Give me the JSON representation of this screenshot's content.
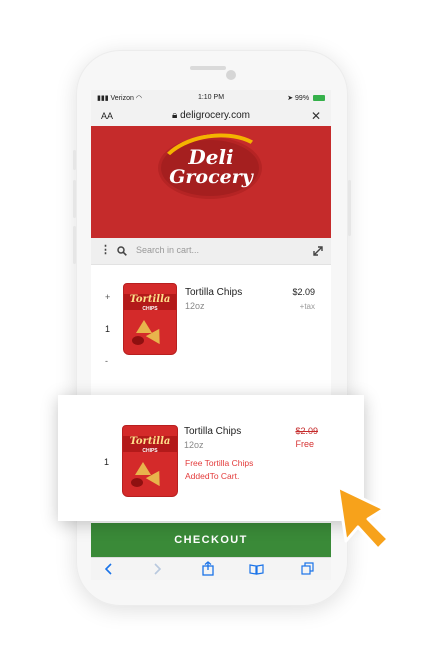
{
  "status_bar": {
    "carrier": "Verizon",
    "time": "1:10 PM",
    "battery": "99%"
  },
  "browser": {
    "text_size": "AA",
    "url": "deligrocery.com",
    "close": "✕"
  },
  "brand": {
    "logo_line1": "Deli",
    "logo_line2": "Grocery",
    "accent": "#c52b2b",
    "logo_gold": "#f4b400"
  },
  "search": {
    "placeholder": ""
  },
  "cart_bar": {
    "placeholder": "Search in cart..."
  },
  "cart_item": {
    "plus": "+",
    "qty": "1",
    "minus": "-",
    "bag_brand": "Tortilla",
    "bag_sub": "CHIPS",
    "name": "Tortilla Chips",
    "size": "12oz",
    "price": "$2.09",
    "tax": "+tax"
  },
  "popup": {
    "qty": "1",
    "name": "Tortilla Chips",
    "size": "12oz",
    "old_price": "$2.09",
    "price_label": "Free",
    "message_line1": "Free Tortilla Chips",
    "message_line2": "AddedTo Cart."
  },
  "checkout": {
    "label": "CHECKOUT",
    "color": "#3a8a38"
  },
  "icons": {
    "menu": "menu-icon",
    "search": "search-icon",
    "filter": "filter-icon",
    "next": "chevron-right-icon",
    "cart_search": "magnifier-icon",
    "expand": "expand-icon",
    "back": "back-icon",
    "forward": "forward-icon",
    "share": "share-icon",
    "bookmarks": "book-icon",
    "tabs": "tabs-icon",
    "cursor": "pointer-arrow-icon"
  }
}
